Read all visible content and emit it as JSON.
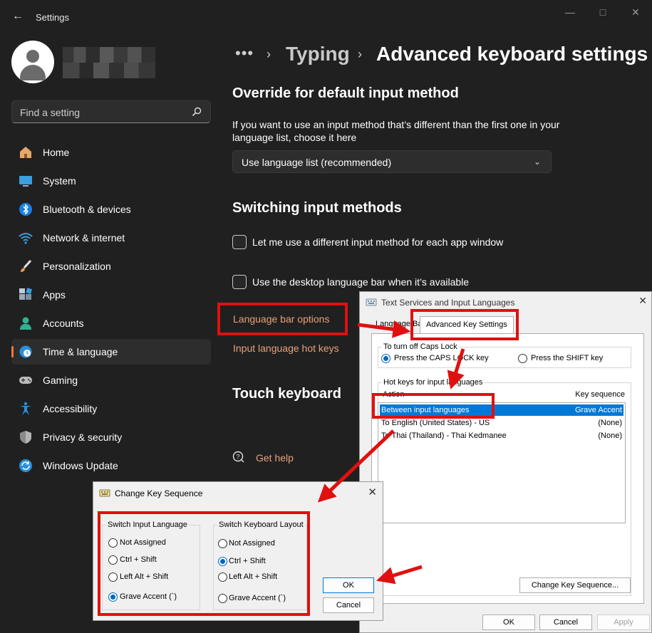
{
  "window": {
    "title": "Settings"
  },
  "search": {
    "placeholder": "Find a setting"
  },
  "nav": [
    {
      "label": "Home"
    },
    {
      "label": "System"
    },
    {
      "label": "Bluetooth & devices"
    },
    {
      "label": "Network & internet"
    },
    {
      "label": "Personalization"
    },
    {
      "label": "Apps"
    },
    {
      "label": "Accounts"
    },
    {
      "label": "Time & language",
      "active": true
    },
    {
      "label": "Gaming"
    },
    {
      "label": "Accessibility"
    },
    {
      "label": "Privacy & security"
    },
    {
      "label": "Windows Update"
    }
  ],
  "breadcrumb": {
    "dots": "•••",
    "parent": "Typing",
    "current": "Advanced keyboard settings"
  },
  "override": {
    "heading": "Override for default input method",
    "description": "If you want to use an input method that’s different than the first one in your language list, choose it here",
    "dropdown_value": "Use language list (recommended)"
  },
  "switching": {
    "heading": "Switching input methods",
    "option1": "Let me use a different input method for each app window",
    "option2": "Use the desktop language bar when it’s available",
    "link_language_bar": "Language bar options",
    "link_hotkeys": "Input language hot keys"
  },
  "touch": {
    "heading": "Touch keyboard"
  },
  "help": {
    "label": "Get help"
  },
  "tsil": {
    "title": "Text Services and Input Languages",
    "tab_language_bar": "Language Bar",
    "tab_advanced": "Advanced Key Settings",
    "caps_group": "To turn off Caps Lock",
    "caps_option1": "Press the CAPS LOCK key",
    "caps_option2": "Press the SHIFT key",
    "hotkeys_group": "Hot keys for input languages",
    "col_action": "Action",
    "col_key": "Key sequence",
    "rows": [
      {
        "action": "Between input languages",
        "key": "Grave Accent"
      },
      {
        "action": "To English (United States) - US",
        "key": "(None)"
      },
      {
        "action": "To Thai (Thailand) - Thai Kedmanee",
        "key": "(None)"
      }
    ],
    "change_button": "Change Key Sequence...",
    "ok": "OK",
    "cancel": "Cancel",
    "apply": "Apply"
  },
  "cks": {
    "title": "Change Key Sequence",
    "group_input": "Switch Input Language",
    "group_layout": "Switch Keyboard Layout",
    "input_options": [
      "Not Assigned",
      "Ctrl + Shift",
      "Left Alt + Shift",
      "Grave Accent (`)"
    ],
    "layout_options": [
      "Not Assigned",
      "Ctrl + Shift",
      "Left Alt + Shift",
      "Grave Accent (`)"
    ],
    "ok": "OK",
    "cancel": "Cancel"
  },
  "colors": {
    "accent": "#e8793a",
    "link": "#e8a27c",
    "highlight": "#e01010",
    "selection": "#0078d7"
  }
}
